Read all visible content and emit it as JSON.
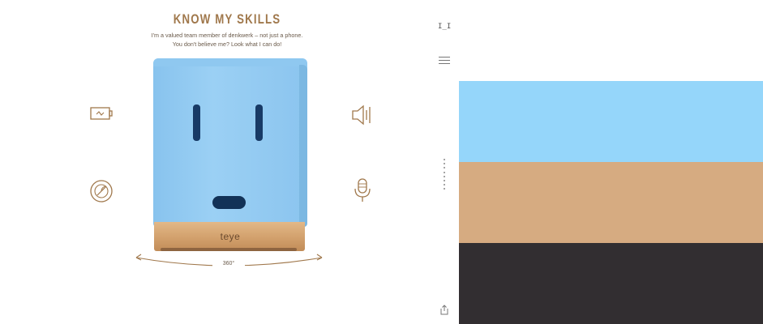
{
  "header": {
    "title": "KNOW MY SKILLS",
    "intro_line_1": "I'm a valued team member of denkwerk – not just a phone.",
    "intro_line_2": "You don't believe me? Look what I can do!"
  },
  "device": {
    "brand": "teye",
    "rotation_label": "360°"
  },
  "skills": [
    {
      "icon": "battery-icon"
    },
    {
      "icon": "speaker-icon"
    },
    {
      "icon": "radar-icon"
    },
    {
      "icon": "microphone-icon"
    }
  ],
  "rail": {
    "logo": "I_I",
    "icons": [
      "menu-icon",
      "share-icon"
    ]
  },
  "swatches": {
    "colors": [
      "#95d6fa",
      "#d6ab81",
      "#322e31"
    ]
  },
  "colors": {
    "accent": "#a0784c",
    "device_blue": "#95d6fa",
    "wood": "#d6ab81",
    "dark": "#322e31"
  }
}
